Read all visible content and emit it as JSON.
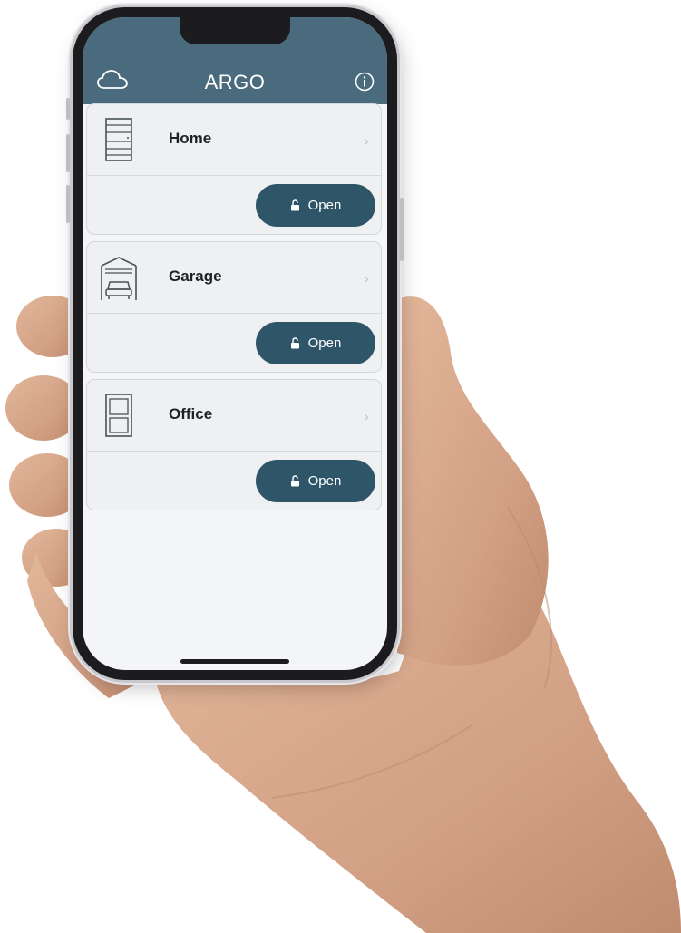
{
  "header": {
    "title": "ARGO",
    "left_icon": "cloud-icon",
    "right_icon": "info-icon",
    "color": "#4a6b7e"
  },
  "doors": [
    {
      "name": "Home",
      "icon": "door-icon",
      "action": "Open"
    },
    {
      "name": "Garage",
      "icon": "garage-icon",
      "action": "Open"
    },
    {
      "name": "Office",
      "icon": "office-door-icon",
      "action": "Open"
    }
  ],
  "colors": {
    "button": "#2e5568",
    "card_background": "#eef0f1",
    "screen_background": "#f4f5f6"
  }
}
